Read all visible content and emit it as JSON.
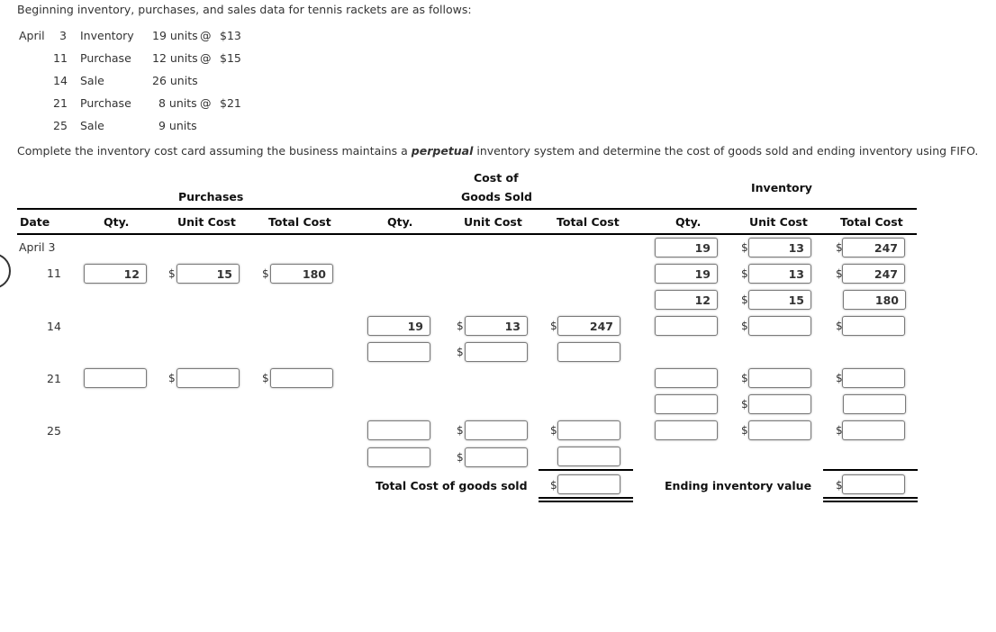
{
  "intro": "Beginning inventory, purchases, and sales data for tennis rackets are as follows:",
  "given": [
    {
      "month": "April",
      "day": "3",
      "type": "Inventory",
      "units": "19 units",
      "at": "@",
      "cost": "$13"
    },
    {
      "month": "",
      "day": "11",
      "type": "Purchase",
      "units": "12 units",
      "at": "@",
      "cost": "$15"
    },
    {
      "month": "",
      "day": "14",
      "type": "Sale",
      "units": "26 units",
      "at": "",
      "cost": ""
    },
    {
      "month": "",
      "day": "21",
      "type": "Purchase",
      "units": "8 units",
      "at": "@",
      "cost": "$21"
    },
    {
      "month": "",
      "day": "25",
      "type": "Sale",
      "units": "9 units",
      "at": "",
      "cost": ""
    }
  ],
  "instruction": {
    "before": "Complete the inventory cost card assuming the business maintains a ",
    "emphasis": "perpetual",
    "after": " inventory system and determine the cost of goods sold and ending inventory using FIFO."
  },
  "table": {
    "group_headers": {
      "purchases": "Purchases",
      "cogs_line1": "Cost of",
      "cogs_line2": "Goods Sold",
      "inventory": "Inventory"
    },
    "columns": [
      "Date",
      "Qty.",
      "Unit Cost",
      "Total Cost",
      "Qty.",
      "Unit Cost",
      "Total Cost",
      "Qty.",
      "Unit Cost",
      "Total Cost"
    ],
    "currency_symbol": "$",
    "dates": [
      "April  3",
      "11",
      "14",
      "21",
      "25"
    ],
    "rows": {
      "apr3": {
        "inventory": [
          {
            "qty": "19",
            "unit": "13",
            "total": "247"
          }
        ]
      },
      "apr11": {
        "purchases": {
          "qty": "12",
          "unit": "15",
          "total": "180"
        },
        "inventory": [
          {
            "qty": "19",
            "unit": "13",
            "total": "247"
          },
          {
            "qty": "12",
            "unit": "15",
            "total": "180"
          }
        ]
      },
      "apr14": {
        "cogs": [
          {
            "qty": "19",
            "unit": "13",
            "total": "247"
          },
          {
            "qty": "",
            "unit": "",
            "total": ""
          }
        ],
        "inventory": [
          {
            "qty": "",
            "unit": "",
            "total": ""
          }
        ]
      },
      "apr21": {
        "purchases": {
          "qty": "",
          "unit": "",
          "total": ""
        },
        "inventory": [
          {
            "qty": "",
            "unit": "",
            "total": ""
          },
          {
            "qty": "",
            "unit": "",
            "total": ""
          },
          {
            "qty": "",
            "unit": "",
            "total": ""
          }
        ]
      },
      "apr25": {
        "cogs": [
          {
            "qty": "",
            "unit": "",
            "total": ""
          },
          {
            "qty": "",
            "unit": "",
            "total": ""
          }
        ]
      }
    },
    "totals": {
      "cogs_label": "Total Cost of goods sold",
      "cogs_value": "",
      "ending_label": "Ending inventory value",
      "ending_value": ""
    }
  }
}
